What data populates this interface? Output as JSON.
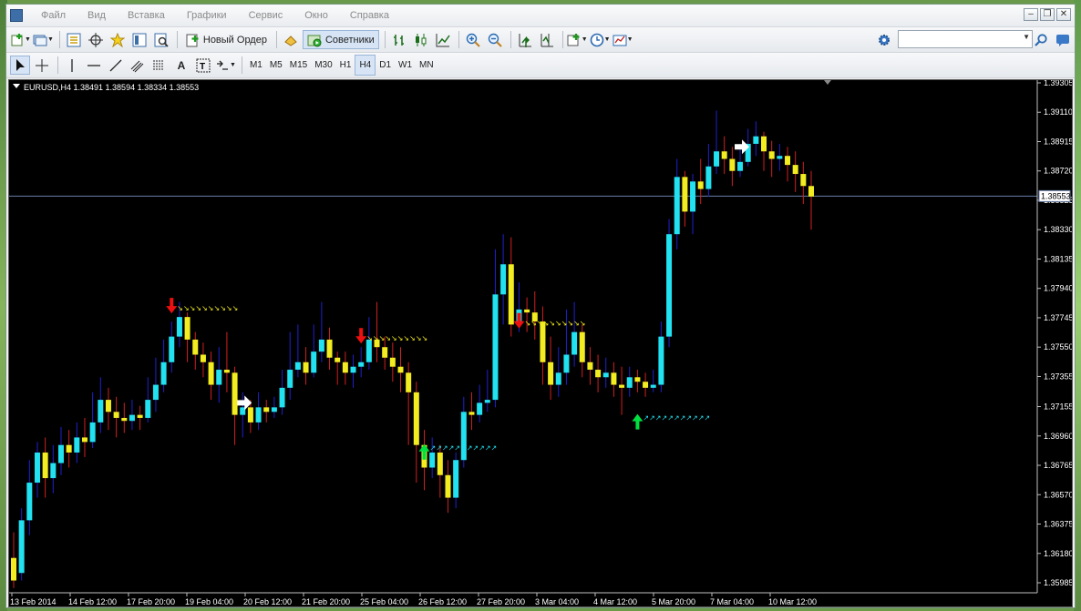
{
  "menu": [
    "Файл",
    "Вид",
    "Вставка",
    "Графики",
    "Сервис",
    "Окно",
    "Справка"
  ],
  "toolbar": {
    "new_order_label": "Новый Ордер",
    "advisors_label": "Советники",
    "timeframes": [
      "M1",
      "M5",
      "M15",
      "M30",
      "H1",
      "H4",
      "D1",
      "W1",
      "MN"
    ],
    "selected_timeframe": "H4",
    "search_placeholder": ""
  },
  "chart_data": {
    "type": "candlestick",
    "title": "EURUSD,H4 1.38491 1.38594 1.38334 1.38553",
    "symbol": "EURUSD",
    "timeframe": "H4",
    "ohlc": {
      "open": 1.38491,
      "high": 1.38594,
      "low": 1.38334,
      "close": 1.38553
    },
    "current_price": 1.38553,
    "current_price_label": "1.38553",
    "ylim": [
      1.35985,
      1.39305
    ],
    "y_ticks": [
      "1.39305",
      "1.39110",
      "1.38915",
      "1.38720",
      "1.38525",
      "1.38330",
      "1.38135",
      "1.37940",
      "1.37745",
      "1.37550",
      "1.37355",
      "1.37155",
      "1.36960",
      "1.36765",
      "1.36570",
      "1.36375",
      "1.36180",
      "1.35985"
    ],
    "x_ticks": [
      "13 Feb 2014",
      "14 Feb 12:00",
      "17 Feb 20:00",
      "19 Feb 04:00",
      "20 Feb 12:00",
      "21 Feb 20:00",
      "25 Feb 04:00",
      "26 Feb 12:00",
      "27 Feb 20:00",
      "3 Mar 04:00",
      "4 Mar 12:00",
      "5 Mar 20:00",
      "7 Mar 04:00",
      "10 Mar 12:00"
    ],
    "colors": {
      "bull": "#22e1f0",
      "bear": "#f2ec20",
      "wick_up": "#2020d0",
      "wick_down": "#d02020",
      "arrow_buy": "#00e040",
      "arrow_sell": "#ee1010",
      "arrow_exit": "#ffffff",
      "price_line": "#6a7fa8"
    },
    "candles": [
      [
        1.3615,
        1.36,
        1.3632,
        1.3595
      ],
      [
        1.3605,
        1.364,
        1.3648,
        1.36
      ],
      [
        1.364,
        1.3665,
        1.368,
        1.363
      ],
      [
        1.3665,
        1.3685,
        1.3692,
        1.3655
      ],
      [
        1.3685,
        1.3668,
        1.3695,
        1.3655
      ],
      [
        1.3668,
        1.3678,
        1.369,
        1.3658
      ],
      [
        1.3678,
        1.369,
        1.3702,
        1.367
      ],
      [
        1.369,
        1.3685,
        1.37,
        1.3675
      ],
      [
        1.3685,
        1.3695,
        1.3705,
        1.3678
      ],
      [
        1.3695,
        1.3692,
        1.3708,
        1.3682
      ],
      [
        1.3692,
        1.3705,
        1.3725,
        1.3688
      ],
      [
        1.3705,
        1.372,
        1.3735,
        1.3698
      ],
      [
        1.372,
        1.3712,
        1.3728,
        1.37
      ],
      [
        1.3712,
        1.3708,
        1.3722,
        1.3695
      ],
      [
        1.3708,
        1.3706,
        1.3718,
        1.3698
      ],
      [
        1.3706,
        1.371,
        1.372,
        1.37
      ],
      [
        1.371,
        1.3708,
        1.3716,
        1.37
      ],
      [
        1.3708,
        1.372,
        1.3735,
        1.3705
      ],
      [
        1.372,
        1.373,
        1.3748,
        1.3712
      ],
      [
        1.373,
        1.3745,
        1.376,
        1.3725
      ],
      [
        1.3745,
        1.3762,
        1.3772,
        1.3738
      ],
      [
        1.3762,
        1.3775,
        1.3785,
        1.3755
      ],
      [
        1.3775,
        1.376,
        1.3778,
        1.3745
      ],
      [
        1.376,
        1.375,
        1.3765,
        1.374
      ],
      [
        1.375,
        1.3745,
        1.3758,
        1.3735
      ],
      [
        1.3745,
        1.373,
        1.3752,
        1.372
      ],
      [
        1.373,
        1.374,
        1.3755,
        1.3718
      ],
      [
        1.374,
        1.3738,
        1.3765,
        1.3725
      ],
      [
        1.3738,
        1.371,
        1.3742,
        1.369
      ],
      [
        1.371,
        1.3715,
        1.3725,
        1.3695
      ],
      [
        1.3715,
        1.3705,
        1.372,
        1.3698
      ],
      [
        1.3705,
        1.3715,
        1.3725,
        1.37
      ],
      [
        1.3715,
        1.3712,
        1.372,
        1.3705
      ],
      [
        1.3712,
        1.3715,
        1.3722,
        1.3708
      ],
      [
        1.3715,
        1.3728,
        1.374,
        1.371
      ],
      [
        1.3728,
        1.374,
        1.3765,
        1.372
      ],
      [
        1.374,
        1.3745,
        1.377,
        1.3735
      ],
      [
        1.3745,
        1.3738,
        1.3755,
        1.373
      ],
      [
        1.3738,
        1.3752,
        1.377,
        1.3735
      ],
      [
        1.3752,
        1.376,
        1.3785,
        1.3745
      ],
      [
        1.376,
        1.3748,
        1.3768,
        1.374
      ],
      [
        1.3748,
        1.3745,
        1.3752,
        1.373
      ],
      [
        1.3745,
        1.3738,
        1.3752,
        1.373
      ],
      [
        1.3738,
        1.3742,
        1.375,
        1.3728
      ],
      [
        1.3742,
        1.3745,
        1.3755,
        1.3735
      ],
      [
        1.3745,
        1.376,
        1.3775,
        1.374
      ],
      [
        1.376,
        1.3755,
        1.3785,
        1.3745
      ],
      [
        1.3755,
        1.3748,
        1.3762,
        1.374
      ],
      [
        1.3748,
        1.3742,
        1.3758,
        1.3732
      ],
      [
        1.3742,
        1.3738,
        1.3755,
        1.3725
      ],
      [
        1.3738,
        1.3725,
        1.3745,
        1.369
      ],
      [
        1.3725,
        1.369,
        1.3732,
        1.3665
      ],
      [
        1.369,
        1.3675,
        1.37,
        1.366
      ],
      [
        1.3675,
        1.3685,
        1.3695,
        1.3668
      ],
      [
        1.3685,
        1.367,
        1.369,
        1.3655
      ],
      [
        1.367,
        1.3655,
        1.368,
        1.3645
      ],
      [
        1.3655,
        1.368,
        1.3685,
        1.3648
      ],
      [
        1.368,
        1.3712,
        1.3722,
        1.3675
      ],
      [
        1.3712,
        1.371,
        1.3725,
        1.37
      ],
      [
        1.371,
        1.3718,
        1.373,
        1.3705
      ],
      [
        1.3718,
        1.372,
        1.374,
        1.3712
      ],
      [
        1.372,
        1.379,
        1.382,
        1.3715
      ],
      [
        1.379,
        1.381,
        1.383,
        1.377
      ],
      [
        1.381,
        1.377,
        1.3828,
        1.3762
      ],
      [
        1.377,
        1.378,
        1.3798,
        1.3765
      ],
      [
        1.378,
        1.3778,
        1.3788,
        1.3765
      ],
      [
        1.3778,
        1.3772,
        1.3792,
        1.376
      ],
      [
        1.3772,
        1.3745,
        1.3782,
        1.373
      ],
      [
        1.3745,
        1.373,
        1.3762,
        1.372
      ],
      [
        1.373,
        1.3738,
        1.3755,
        1.3722
      ],
      [
        1.3738,
        1.375,
        1.378,
        1.373
      ],
      [
        1.375,
        1.3765,
        1.3785,
        1.3742
      ],
      [
        1.3765,
        1.3745,
        1.377,
        1.3735
      ],
      [
        1.3745,
        1.374,
        1.3755,
        1.373
      ],
      [
        1.374,
        1.3735,
        1.375,
        1.3725
      ],
      [
        1.3735,
        1.3738,
        1.3748,
        1.3728
      ],
      [
        1.3738,
        1.373,
        1.3745,
        1.3722
      ],
      [
        1.373,
        1.3728,
        1.3742,
        1.371
      ],
      [
        1.3728,
        1.3735,
        1.3742,
        1.3722
      ],
      [
        1.3735,
        1.3732,
        1.374,
        1.3725
      ],
      [
        1.3732,
        1.3728,
        1.3738,
        1.3722
      ],
      [
        1.3728,
        1.373,
        1.374,
        1.3725
      ],
      [
        1.373,
        1.3762,
        1.3772,
        1.3725
      ],
      [
        1.3762,
        1.383,
        1.384,
        1.3755
      ],
      [
        1.383,
        1.3868,
        1.388,
        1.382
      ],
      [
        1.3868,
        1.3845,
        1.3872,
        1.3835
      ],
      [
        1.3845,
        1.3865,
        1.387,
        1.383
      ],
      [
        1.3865,
        1.386,
        1.388,
        1.385
      ],
      [
        1.386,
        1.3875,
        1.389,
        1.3855
      ],
      [
        1.3875,
        1.3885,
        1.3912,
        1.387
      ],
      [
        1.3885,
        1.388,
        1.3895,
        1.387
      ],
      [
        1.388,
        1.3872,
        1.3888,
        1.3862
      ],
      [
        1.3872,
        1.3878,
        1.389,
        1.3868
      ],
      [
        1.3878,
        1.389,
        1.39,
        1.3875
      ],
      [
        1.389,
        1.3895,
        1.3905,
        1.3882
      ],
      [
        1.3895,
        1.3885,
        1.3898,
        1.3872
      ],
      [
        1.3885,
        1.388,
        1.3892,
        1.3868
      ],
      [
        1.388,
        1.3882,
        1.389,
        1.3872
      ],
      [
        1.3882,
        1.3876,
        1.3888,
        1.3865
      ],
      [
        1.3876,
        1.387,
        1.3885,
        1.3858
      ],
      [
        1.387,
        1.3862,
        1.3878,
        1.385
      ],
      [
        1.3862,
        1.3855,
        1.3872,
        1.3833
      ]
    ],
    "signals": [
      {
        "type": "sell",
        "index": 20,
        "price": 1.3778
      },
      {
        "type": "exit",
        "index": 29,
        "price": 1.3718
      },
      {
        "type": "sell",
        "index": 44,
        "price": 1.3758
      },
      {
        "type": "buy",
        "index": 52,
        "price": 1.369
      },
      {
        "type": "sell",
        "index": 64,
        "price": 1.3768
      },
      {
        "type": "buy",
        "index": 79,
        "price": 1.371
      },
      {
        "type": "exit",
        "index": 92,
        "price": 1.3888
      }
    ]
  }
}
